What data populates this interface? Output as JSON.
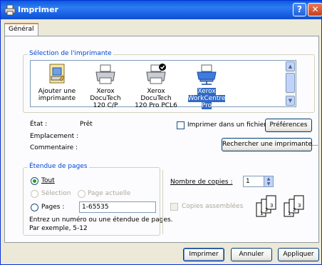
{
  "window": {
    "title": "Imprimer",
    "help_glyph": "?",
    "close_glyph": "✕"
  },
  "tabs": [
    {
      "label": "Général"
    }
  ],
  "printer_selection": {
    "group_label": "Sélection de l'imprimante",
    "printers": [
      {
        "line1": "Ajouter une",
        "line2": "imprimante",
        "icon": "add-printer-icon"
      },
      {
        "line1": "Xerox DocuTech",
        "line2": "120 C/P",
        "icon": "printer-icon"
      },
      {
        "line1": "Xerox DocuTech",
        "line2": "120 Pro PCL6",
        "icon": "default-printer-icon"
      },
      {
        "line1": "Xerox",
        "line2": "WorkCentre Pro",
        "icon": "network-printer-icon",
        "selected": true
      }
    ],
    "status_label": "État :",
    "status_value": "Prêt",
    "location_label": "Emplacement :",
    "comment_label": "Commentaire :",
    "print_to_file_label": "Imprimer dans un fichier",
    "preferences_button": "Préférences",
    "find_printer_button": "Rechercher une imprimante..."
  },
  "page_range": {
    "group_label": "Étendue de pages",
    "all_label": "Tout",
    "selection_label": "Sélection",
    "current_page_label": "Page actuelle",
    "pages_label": "Pages :",
    "pages_value": "1-65535",
    "help_line1": "Entrez un numéro ou une étendue de pages.",
    "help_line2": "Par exemple, 5-12"
  },
  "copies": {
    "count_label": "Nombre de copies :",
    "count_value": "1",
    "collate_label": "Copies assemblées",
    "collate_digits": [
      "1",
      "2",
      "3"
    ]
  },
  "footer": {
    "print_button": "Imprimer",
    "cancel_button": "Annuler",
    "apply_button": "Appliquer"
  }
}
